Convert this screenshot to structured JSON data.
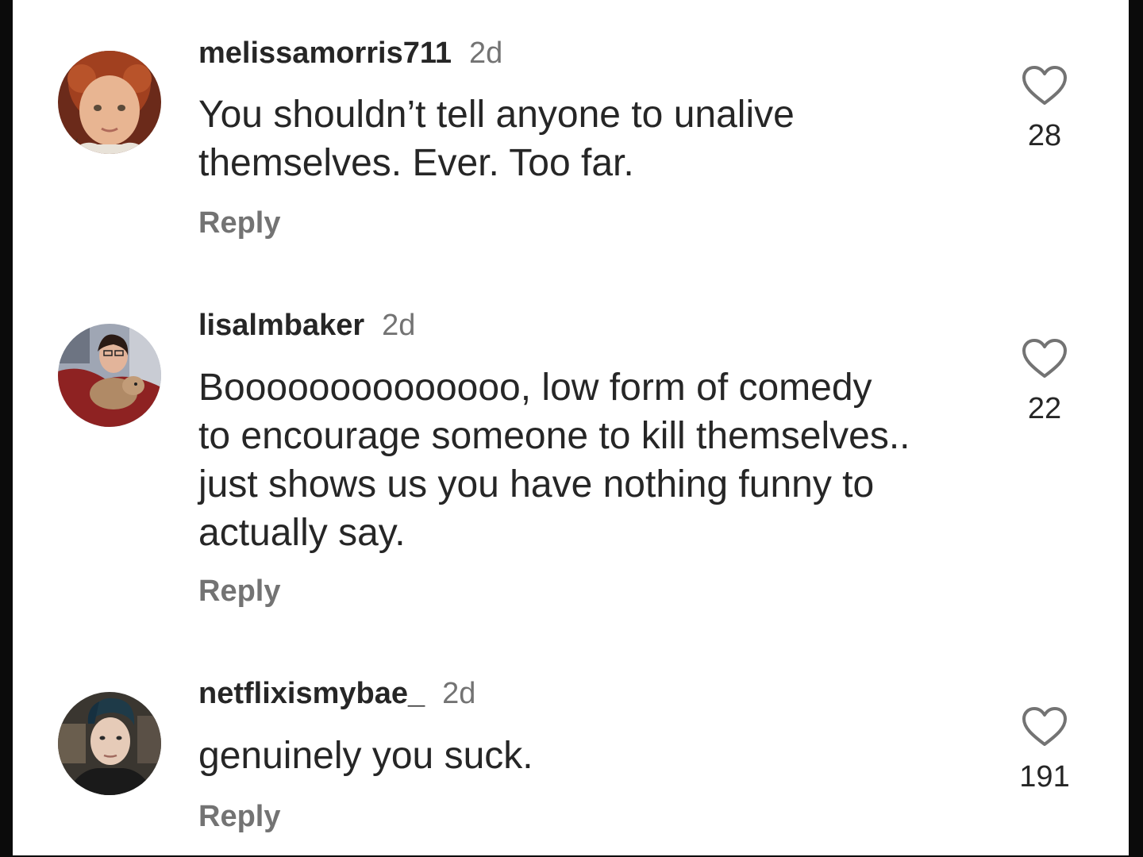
{
  "comments": [
    {
      "username": "melissamorris711",
      "time": "2d",
      "text": "You shouldn’t tell anyone to unalive\nthemselves.  Ever.  Too far.",
      "reply_label": "Reply",
      "likes": "28",
      "avatar_icon": "child-portrait-avatar"
    },
    {
      "username": "lisalmbaker",
      "time": "2d",
      "text": "Boooooooooooooo, low form of comedy\nto encourage someone to kill themselves..\njust shows us you have nothing funny to\nactually say.",
      "reply_label": "Reply",
      "likes": "22",
      "avatar_icon": "woman-with-dog-avatar"
    },
    {
      "username": "netflixismybae_",
      "time": "2d",
      "text": "genuinely you suck.",
      "reply_label": "Reply",
      "likes": "191",
      "avatar_icon": "person-portrait-avatar"
    }
  ],
  "colors": {
    "text_primary": "#262626",
    "text_secondary": "#737373",
    "background": "#ffffff"
  }
}
